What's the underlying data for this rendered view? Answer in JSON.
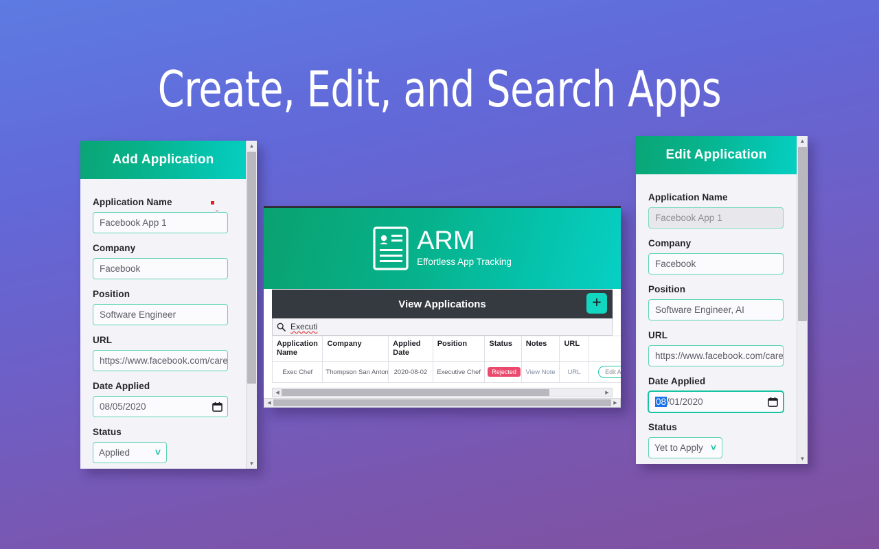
{
  "page": {
    "title": "Create, Edit, and Search Apps",
    "background_top": "#5d7be2",
    "background_bottom": "#80509e"
  },
  "add_panel": {
    "header_title": "Add Application",
    "accent": "#05c3ad",
    "fields": [
      {
        "label": "Application Name",
        "value": "Facebook App 1"
      },
      {
        "label": "Company",
        "value": "Facebook"
      },
      {
        "label": "Position",
        "value": "Software Engineer"
      },
      {
        "label": "URL",
        "value": "https://www.facebook.com/caree"
      },
      {
        "label": "Date Applied",
        "value": "08/05/2020"
      },
      {
        "label": "Status",
        "value": "Applied"
      }
    ],
    "calendar_icon": "calendar-icon",
    "chevron": "chevron-down-icon"
  },
  "edit_panel": {
    "header_title": "Edit Application",
    "accent": "#05c3ad",
    "fields": [
      {
        "label": "Application Name",
        "value": "Facebook App 1"
      },
      {
        "label": "Company",
        "value": "Facebook"
      },
      {
        "label": "Position",
        "value": "Software Engineer, AI"
      },
      {
        "label": "URL",
        "value": "https://www.facebook.com/caree"
      },
      {
        "label": "Date Applied",
        "value_selected": "08",
        "value_rest": "/01/2020"
      },
      {
        "label": "Status",
        "value": "Yet to Apply"
      }
    ],
    "calendar_icon": "calendar-icon",
    "chevron": "chevron-down-icon"
  },
  "arm_window": {
    "brand_name": "ARM",
    "brand_tagline": "Effortless App Tracking",
    "logo_icon": "resume-card-icon",
    "card_title": "View Applications",
    "add_button_label": "+",
    "search": {
      "icon": "search-icon",
      "value": "Executi",
      "placeholder": "Search"
    },
    "table": {
      "columns": [
        "Application Name",
        "Company",
        "Applied Date",
        "Position",
        "Status",
        "Notes",
        "URL",
        ""
      ],
      "rows": [
        {
          "application_name": "Exec Chef",
          "company": "Thompson San Antonio",
          "applied_date": "2020-08-02",
          "position": "Executive Chef",
          "status": "Rejected",
          "status_color": "#ec4a6d",
          "notes": "View Note",
          "url": "URL",
          "action": "Edit A"
        }
      ]
    }
  }
}
